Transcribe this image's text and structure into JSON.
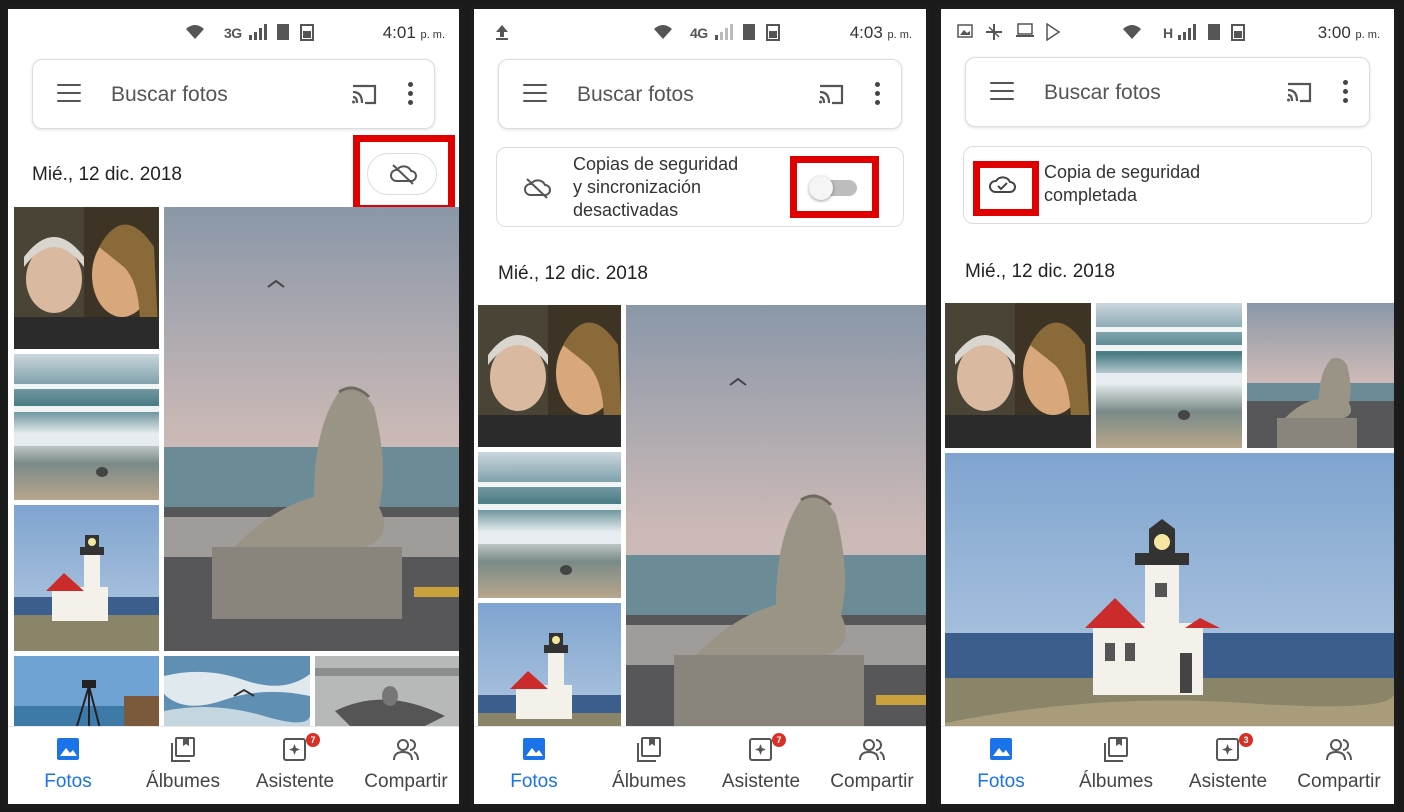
{
  "panels": [
    {
      "status": {
        "network": "3G",
        "time": "4:01",
        "ampm": "p. m."
      },
      "search": {
        "placeholder": "Buscar fotos"
      },
      "date_header": "Mié., 12 dic. 2018",
      "cloud_status_icon": "cloud-off-icon"
    },
    {
      "status": {
        "network": "4G",
        "time": "4:03",
        "ampm": "p. m."
      },
      "search": {
        "placeholder": "Buscar fotos"
      },
      "backup_card": {
        "line1": "Copias de seguridad",
        "line2": "y sincronización",
        "line3": "desactivadas",
        "toggle_on": false
      },
      "date_header": "Mié., 12 dic. 2018"
    },
    {
      "status": {
        "network": "H",
        "time": "3:00",
        "ampm": "p. m."
      },
      "search": {
        "placeholder": "Buscar fotos"
      },
      "backup_card": {
        "line1": "Copia de seguridad",
        "line2": "completada"
      },
      "date_header": "Mié., 12 dic. 2018"
    }
  ],
  "nav": {
    "fotos": "Fotos",
    "albumes": "Álbumes",
    "asistente": "Asistente",
    "compartir": "Compartir",
    "asistente_badge_panel1": "7",
    "asistente_badge_panel2": "7",
    "asistente_badge_panel3": "3"
  },
  "colors": {
    "accent": "#1a73e8",
    "highlight": "#e10000",
    "badge": "#d93025"
  }
}
